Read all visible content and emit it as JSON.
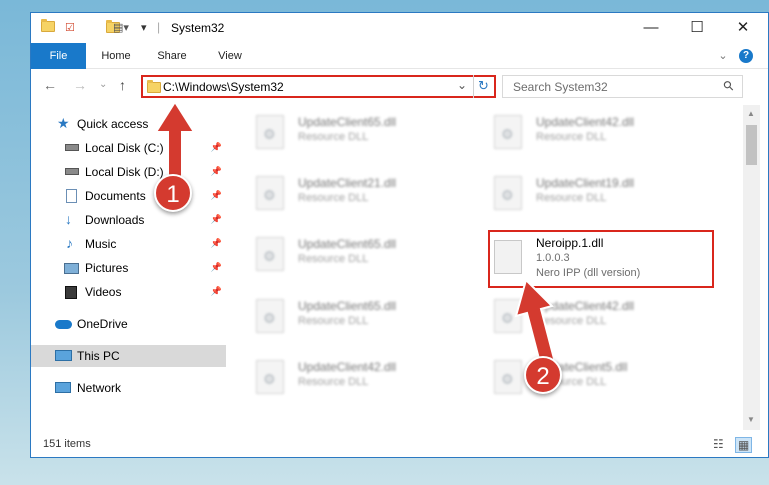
{
  "window": {
    "title": "System32",
    "controls": {
      "minimize": "—",
      "maximize": "☐",
      "close": "✕"
    }
  },
  "ribbon": {
    "tabs": [
      "File",
      "Home",
      "Share",
      "View"
    ],
    "expand": "⌄",
    "help": "?"
  },
  "nav": {
    "back": "←",
    "forward": "→",
    "recent": "⌄",
    "up": "↑",
    "refresh": "↻",
    "dropdown": "⌄"
  },
  "address": {
    "path": "C:\\Windows\\System32"
  },
  "search": {
    "placeholder": "Search System32",
    "icon": "⚲"
  },
  "sidebar": {
    "items": [
      {
        "label": "Quick access",
        "icon": "star-icon",
        "pinned": false
      },
      {
        "label": "Local Disk (C:)",
        "icon": "drive-icon",
        "pinned": true
      },
      {
        "label": "Local Disk (D:)",
        "icon": "drive-icon",
        "pinned": true
      },
      {
        "label": "Documents",
        "icon": "document-icon",
        "pinned": true
      },
      {
        "label": "Downloads",
        "icon": "download-icon",
        "pinned": true
      },
      {
        "label": "Music",
        "icon": "music-icon",
        "pinned": true
      },
      {
        "label": "Pictures",
        "icon": "picture-icon",
        "pinned": true
      },
      {
        "label": "Videos",
        "icon": "video-icon",
        "pinned": true
      },
      {
        "label": "OneDrive",
        "icon": "cloud-icon",
        "pinned": false
      },
      {
        "label": "This PC",
        "icon": "computer-icon",
        "pinned": false,
        "selected": true
      },
      {
        "label": "Network",
        "icon": "network-icon",
        "pinned": false
      }
    ],
    "pin_glyph": "📌"
  },
  "files": [
    {
      "name": "UpdateClient65.dll",
      "desc": "Resource DLL"
    },
    {
      "name": "UpdateClient42.dll",
      "desc": "Resource DLL"
    },
    {
      "name": "UpdateClient21.dll",
      "desc": "Resource DLL"
    },
    {
      "name": "UpdateClient19.dll",
      "desc": "Resource DLL"
    },
    {
      "name": "UpdateClient65.dll",
      "desc": "Resource DLL"
    },
    {
      "name": "UpdateClient65.dll",
      "desc": "Resource DLL"
    },
    {
      "name": "UpdateClient42.dll",
      "desc": "Resource DLL"
    },
    {
      "name": "UpdateClient42.dll",
      "desc": "Resource DLL"
    },
    {
      "name": "UpdateClient5.dll",
      "desc": "Resource DLL"
    }
  ],
  "highlighted_file": {
    "name": "Neroipp.1.dll",
    "version": "1.0.0.3",
    "desc": "Nero IPP (dll version)"
  },
  "status": {
    "count": "151 items"
  },
  "view_buttons": {
    "details": "☷",
    "tiles": "▦"
  },
  "annotations": {
    "step1": "1",
    "step2": "2"
  },
  "colors": {
    "accent": "#1979ca",
    "highlight": "#d9261c",
    "badge": "#d43a2f"
  }
}
